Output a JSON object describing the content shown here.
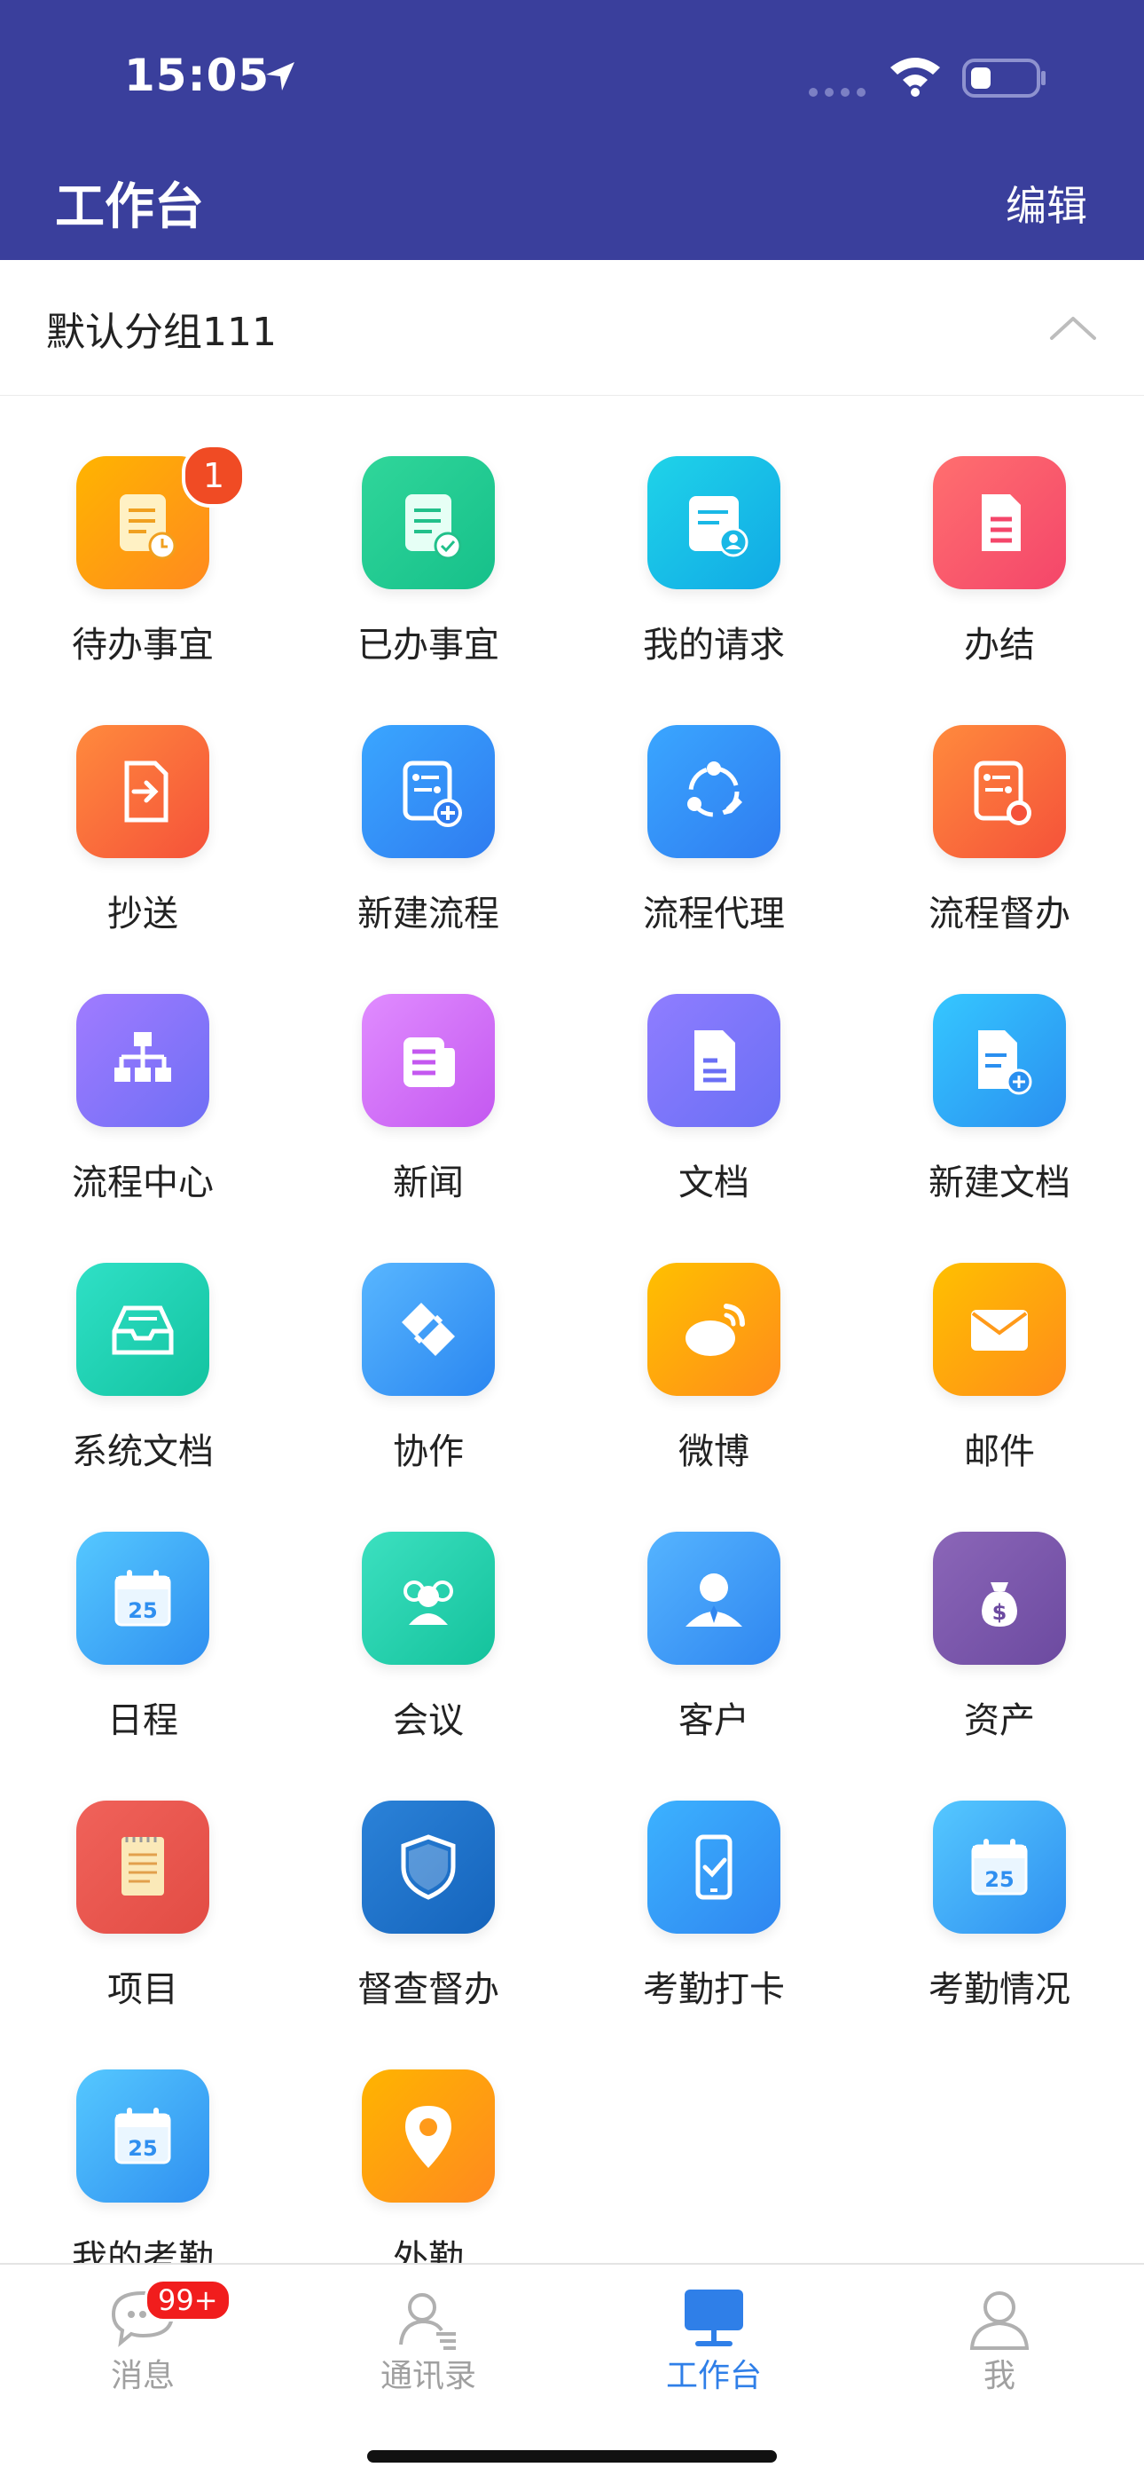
{
  "status_bar": {
    "time": "15:05"
  },
  "header": {
    "title": "工作台",
    "edit_label": "编辑"
  },
  "group": {
    "title": "默认分组111"
  },
  "apps": [
    {
      "label": "待办事宜",
      "icon": "todo-icon",
      "badge": "1",
      "colors": [
        "#ffb400",
        "#ff8a1f"
      ]
    },
    {
      "label": "已办事宜",
      "icon": "done-icon",
      "colors": [
        "#30d69a",
        "#16c08a"
      ]
    },
    {
      "label": "我的请求",
      "icon": "my-request-icon",
      "colors": [
        "#1fd3e8",
        "#11a9e6"
      ]
    },
    {
      "label": "办结",
      "icon": "finished-icon",
      "colors": [
        "#ff6f6f",
        "#f4466a"
      ]
    },
    {
      "label": "抄送",
      "icon": "cc-icon",
      "colors": [
        "#ff8a3d",
        "#f5523a"
      ]
    },
    {
      "label": "新建流程",
      "icon": "new-process-icon",
      "colors": [
        "#3aa6ff",
        "#2f7cf0"
      ]
    },
    {
      "label": "流程代理",
      "icon": "process-agent-icon",
      "colors": [
        "#3aa6ff",
        "#2f7cf0"
      ]
    },
    {
      "label": "流程督办",
      "icon": "process-supervise-icon",
      "colors": [
        "#ff8a3d",
        "#f5523a"
      ]
    },
    {
      "label": "流程中心",
      "icon": "process-center-icon",
      "colors": [
        "#a07bff",
        "#6f6ff5"
      ]
    },
    {
      "label": "新闻",
      "icon": "news-icon",
      "colors": [
        "#e08cff",
        "#c458f0"
      ]
    },
    {
      "label": "文档",
      "icon": "document-icon",
      "colors": [
        "#8f7dff",
        "#6a6ff5"
      ]
    },
    {
      "label": "新建文档",
      "icon": "new-document-icon",
      "colors": [
        "#35c7ff",
        "#2a8ff0"
      ]
    },
    {
      "label": "系统文档",
      "icon": "system-document-icon",
      "colors": [
        "#2fe0c6",
        "#13c3a0"
      ]
    },
    {
      "label": "协作",
      "icon": "collaboration-icon",
      "colors": [
        "#58b6ff",
        "#2a86f0"
      ]
    },
    {
      "label": "微博",
      "icon": "weibo-icon",
      "colors": [
        "#ffc000",
        "#ff8c1a"
      ]
    },
    {
      "label": "邮件",
      "icon": "mail-icon",
      "colors": [
        "#ffc000",
        "#ff8c1a"
      ]
    },
    {
      "label": "日程",
      "icon": "calendar-icon",
      "date": "25",
      "colors": [
        "#55c8ff",
        "#2f8ff0"
      ]
    },
    {
      "label": "会议",
      "icon": "meeting-icon",
      "colors": [
        "#3ce0c0",
        "#14c29c"
      ]
    },
    {
      "label": "客户",
      "icon": "customer-icon",
      "colors": [
        "#55b4ff",
        "#2f86f0"
      ]
    },
    {
      "label": "资产",
      "icon": "asset-icon",
      "colors": [
        "#8b66b8",
        "#6c4aa0"
      ]
    },
    {
      "label": "项目",
      "icon": "project-icon",
      "colors": [
        "#f0625a",
        "#e24c44"
      ]
    },
    {
      "label": "督查督办",
      "icon": "inspection-icon",
      "colors": [
        "#2b82d8",
        "#1564bc"
      ]
    },
    {
      "label": "考勤打卡",
      "icon": "clock-in-icon",
      "colors": [
        "#3cb2ff",
        "#2f86f0"
      ]
    },
    {
      "label": "考勤情况",
      "icon": "attendance-calendar-icon",
      "date": "25",
      "colors": [
        "#55c8ff",
        "#2f8ff0"
      ]
    },
    {
      "label": "我的考勤",
      "icon": "my-attendance-icon",
      "date": "25",
      "colors": [
        "#55c8ff",
        "#2f8ff0"
      ]
    },
    {
      "label": "外勤",
      "icon": "field-work-icon",
      "colors": [
        "#ffb400",
        "#ff8a1f"
      ]
    }
  ],
  "tabs": [
    {
      "label": "消息",
      "icon": "message-icon",
      "badge": "99+"
    },
    {
      "label": "通讯录",
      "icon": "contacts-icon"
    },
    {
      "label": "工作台",
      "icon": "workbench-icon",
      "active": true
    },
    {
      "label": "我",
      "icon": "profile-icon"
    }
  ]
}
